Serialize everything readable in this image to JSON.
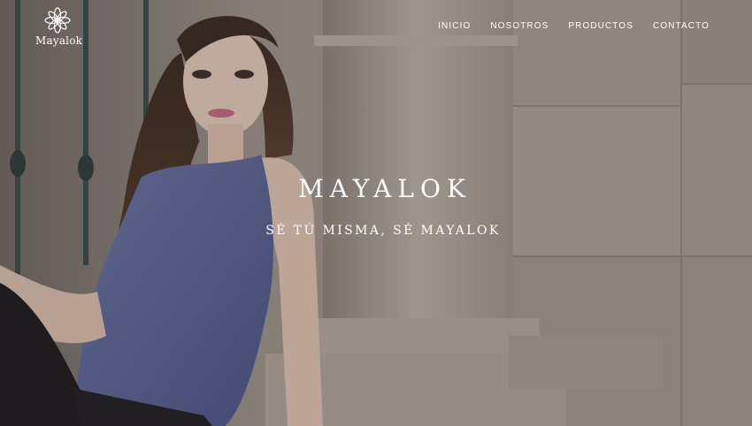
{
  "brand": {
    "logo_text": "Mayalok",
    "logo_icon": "lotus-flower-icon"
  },
  "nav": {
    "items": [
      {
        "label": "INICIO"
      },
      {
        "label": "NOSOTROS"
      },
      {
        "label": "PRODUCTOS"
      },
      {
        "label": "CONTACTO"
      }
    ]
  },
  "hero": {
    "title": "MAYALOK",
    "tagline": "SÉ TÚ MISMA, SÉ MAYALOK"
  },
  "colors": {
    "text": "#ffffff",
    "dress": "#5b6494",
    "stone": "#b8aea5"
  }
}
